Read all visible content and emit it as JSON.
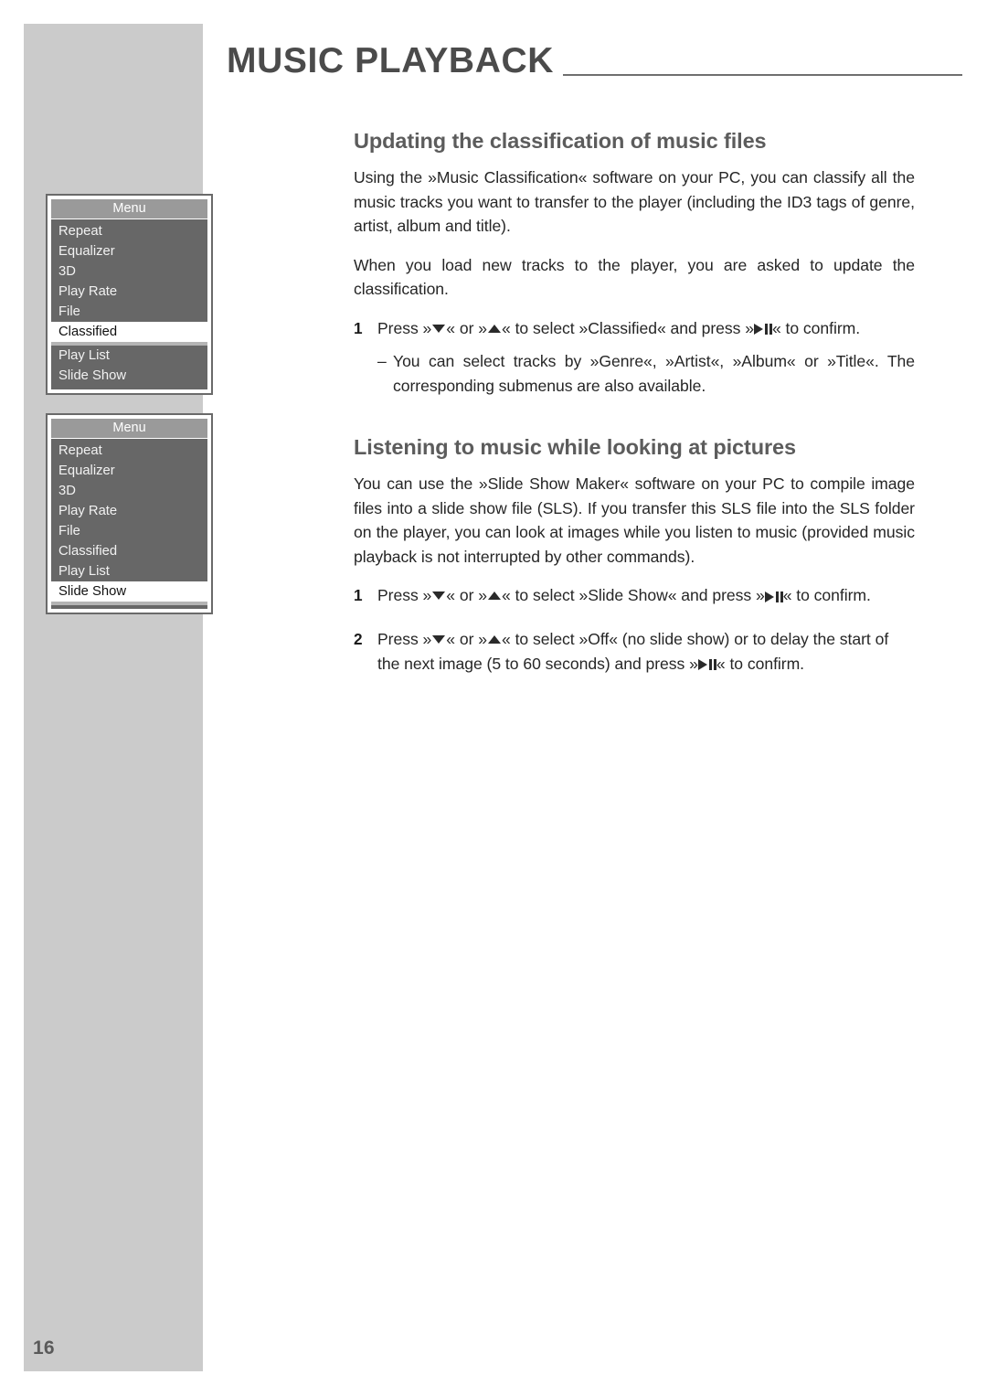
{
  "page": {
    "number": "16",
    "chapter_title": "MUSIC PLAYBACK"
  },
  "sections": [
    {
      "heading": "Updating the classification of music files",
      "paragraphs": [
        "Using the »Music Classification« software on your PC, you can classify all the music tracks you want to transfer to the player (including the ID3 tags of genre, artist, album and title).",
        "When you load new tracks to the player, you are asked to update the classification."
      ],
      "steps": [
        {
          "number": "1",
          "text_before": "Press »",
          "text_middle": "« or »",
          "text_after": "« to select »Classified« and press »",
          "text_end": "« to confirm.",
          "substeps": [
            {
              "dash": "–",
              "text": "You can select tracks by »Genre«, »Artist«, »Album« or »Title«. The corresponding submenus are also available."
            }
          ]
        }
      ]
    },
    {
      "heading": "Listening to music while looking at pictures",
      "paragraphs": [
        "You can use the »Slide Show Maker« software on your PC to compile image files into a slide show file (SLS). If you transfer this SLS file into the SLS folder on the player, you can look at images while you listen to music (provided music playback is not interrupted by other commands)."
      ],
      "steps": [
        {
          "number": "1",
          "text_before": "Press »",
          "text_middle": "« or »",
          "text_after": "« to select »Slide Show« and press »",
          "text_end": "« to confirm."
        },
        {
          "number": "2",
          "text_before": "Press »",
          "text_middle": "« or »",
          "text_after": "« to select »Off« (no slide show) or to delay the start of the next image (5 to 60 seconds) and press »",
          "text_end": "« to confirm."
        }
      ]
    }
  ],
  "device_menus": [
    {
      "title": "Menu",
      "items": [
        {
          "label": "Repeat",
          "selected": false
        },
        {
          "label": "Equalizer",
          "selected": false
        },
        {
          "label": "3D",
          "selected": false
        },
        {
          "label": "Play Rate",
          "selected": false
        },
        {
          "label": "File",
          "selected": false
        },
        {
          "label": "Classified",
          "selected": true
        },
        {
          "label": "Play List",
          "selected": false
        },
        {
          "label": "Slide Show",
          "selected": false
        }
      ]
    },
    {
      "title": "Menu",
      "items": [
        {
          "label": "Repeat",
          "selected": false
        },
        {
          "label": "Equalizer",
          "selected": false
        },
        {
          "label": "3D",
          "selected": false
        },
        {
          "label": "Play Rate",
          "selected": false
        },
        {
          "label": "File",
          "selected": false
        },
        {
          "label": "Classified",
          "selected": false
        },
        {
          "label": "Play List",
          "selected": false
        },
        {
          "label": "Slide Show",
          "selected": true
        }
      ]
    }
  ],
  "icons": {
    "arrow_down": "triangle-down-icon",
    "arrow_up": "triangle-up-icon",
    "play_pause": "play-pause-icon"
  },
  "colors": {
    "side_bar": "#cbcbcb",
    "heading": "#5c5c5c",
    "body_text": "#262626",
    "menu_body": "#676767",
    "menu_title_bar": "#9a9a9a",
    "menu_selected_bg": "#ffffff"
  }
}
